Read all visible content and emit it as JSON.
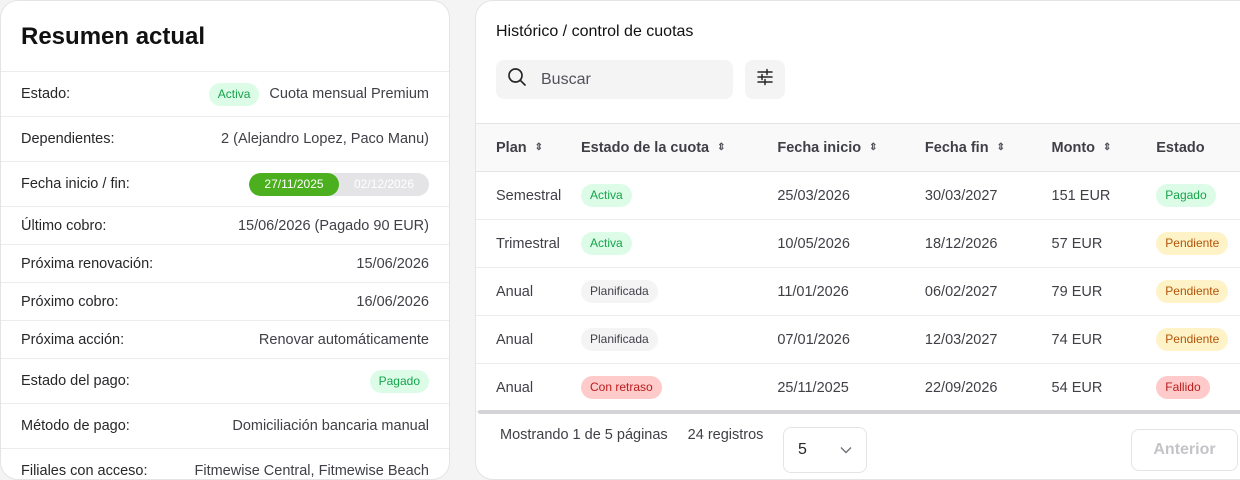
{
  "summary": {
    "title": "Resumen actual",
    "estado_label": "Estado:",
    "estado_badge": "Activa",
    "estado_value": "Cuota mensual Premium",
    "dependientes_label": "Dependientes:",
    "dependientes_value": "2 (Alejandro Lopez, Paco Manu)",
    "fecha_label": "Fecha inicio / fin:",
    "fecha_inicio": "27/11/2025",
    "fecha_fin": "02/12/2026",
    "ultimo_cobro_label": "Último cobro:",
    "ultimo_cobro_value": "15/06/2026 (Pagado 90 EUR)",
    "proxima_renovacion_label": "Próxima renovación:",
    "proxima_renovacion_value": "15/06/2026",
    "proximo_cobro_label": "Próximo cobro:",
    "proximo_cobro_value": "16/06/2026",
    "proxima_accion_label": "Próxima acción:",
    "proxima_accion_value": "Renovar automáticamente",
    "estado_pago_label": "Estado del pago:",
    "estado_pago_badge": "Pagado",
    "metodo_pago_label": "Método de pago:",
    "metodo_pago_value": "Domiciliación bancaria manual",
    "filiales_label": "Filiales con acceso:",
    "filiales_value": "Fitmewise Central, Fitmewise Beach"
  },
  "history": {
    "title": "Histórico / control de cuotas",
    "search_placeholder": "Buscar",
    "columns": [
      "Plan",
      "Estado de la cuota",
      "Fecha inicio",
      "Fecha fin",
      "Monto",
      "Estado"
    ],
    "rows": [
      {
        "plan": "Semestral",
        "estado_cuota": "Activa",
        "estado_cuota_style": "green",
        "inicio": "25/03/2026",
        "fin": "30/03/2027",
        "monto": "151 EUR",
        "estado": "Pagado",
        "estado_style": "green"
      },
      {
        "plan": "Trimestral",
        "estado_cuota": "Activa",
        "estado_cuota_style": "green",
        "inicio": "10/05/2026",
        "fin": "18/12/2026",
        "monto": "57 EUR",
        "estado": "Pendiente",
        "estado_style": "yellow"
      },
      {
        "plan": "Anual",
        "estado_cuota": "Planificada",
        "estado_cuota_style": "gray",
        "inicio": "11/01/2026",
        "fin": "06/02/2027",
        "monto": "79 EUR",
        "estado": "Pendiente",
        "estado_style": "yellow"
      },
      {
        "plan": "Anual",
        "estado_cuota": "Planificada",
        "estado_cuota_style": "gray",
        "inicio": "07/01/2026",
        "fin": "12/03/2027",
        "monto": "74 EUR",
        "estado": "Pendiente",
        "estado_style": "yellow"
      },
      {
        "plan": "Anual",
        "estado_cuota": "Con retraso",
        "estado_cuota_style": "red",
        "inicio": "25/11/2025",
        "fin": "22/09/2026",
        "monto": "54 EUR",
        "estado": "Fallido",
        "estado_style": "red"
      }
    ],
    "footer_pages": "Mostrando 1 de 5 páginas",
    "footer_records": "24 registros",
    "page_size": "5",
    "prev_label": "Anterior"
  }
}
